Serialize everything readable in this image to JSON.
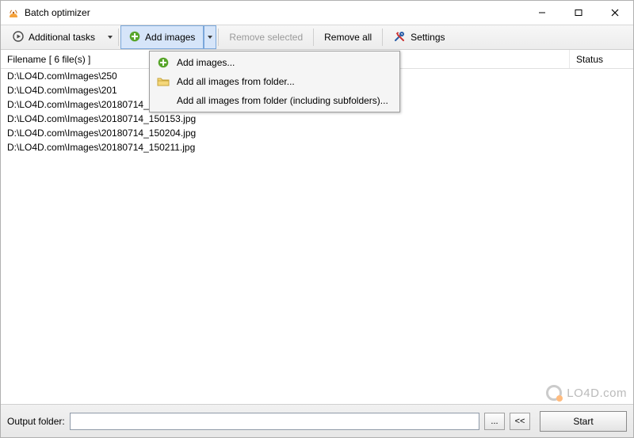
{
  "window": {
    "title": "Batch optimizer"
  },
  "toolbar": {
    "additional_tasks": "Additional tasks",
    "add_images": "Add images",
    "remove_selected": "Remove selected",
    "remove_all": "Remove all",
    "settings": "Settings"
  },
  "columns": {
    "filename_header": "Filename  [ 6 file(s) ]",
    "status_header": "Status"
  },
  "files": [
    "D:\\LO4D.com\\Images\\250",
    "D:\\LO4D.com\\Images\\201",
    "D:\\LO4D.com\\Images\\20180714_140302 - Copy.jpg",
    "D:\\LO4D.com\\Images\\20180714_150153.jpg",
    "D:\\LO4D.com\\Images\\20180714_150204.jpg",
    "D:\\LO4D.com\\Images\\20180714_150211.jpg"
  ],
  "dropdown": {
    "add_images": "Add images...",
    "add_folder": "Add all images from folder...",
    "add_folder_sub": "Add all images from folder (including subfolders)..."
  },
  "bottom": {
    "output_label": "Output folder:",
    "output_value": "",
    "browse": "...",
    "collapse": "<<",
    "start": "Start"
  },
  "watermark": "LO4D.com"
}
